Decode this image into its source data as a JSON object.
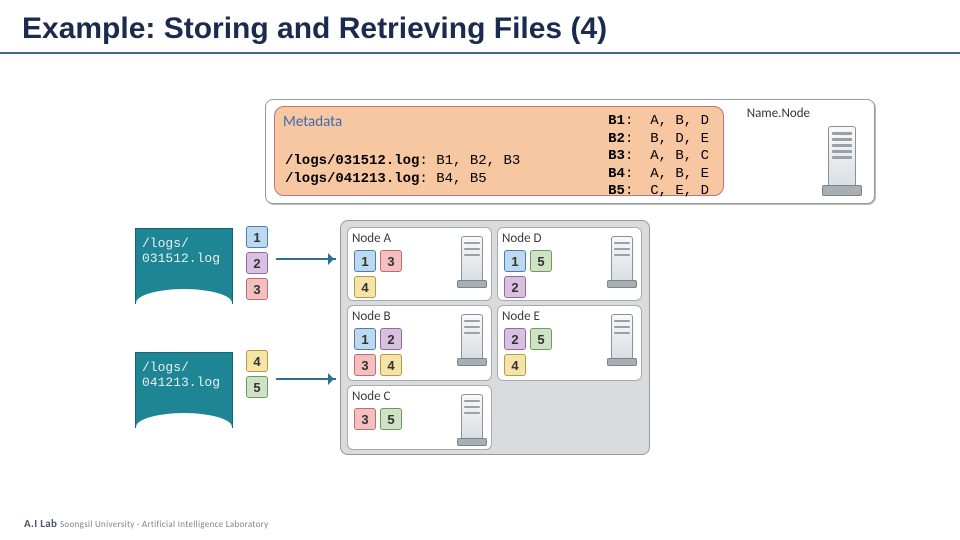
{
  "title": "Example: Storing and Retrieving Files (4)",
  "namenode": {
    "label": "Name.Node",
    "metadata_header": "Metadata",
    "files": [
      {
        "path": "/logs/031512.log",
        "blocks": "B1, B2, B3"
      },
      {
        "path": "/logs/041213.log",
        "blocks": "B4, B5"
      }
    ],
    "block_map": [
      {
        "id": "B1",
        "nodes": "A, B, D"
      },
      {
        "id": "B2",
        "nodes": "B, D, E"
      },
      {
        "id": "B3",
        "nodes": "A, B, C"
      },
      {
        "id": "B4",
        "nodes": "A, B, E"
      },
      {
        "id": "B5",
        "nodes": "C, E, D"
      }
    ]
  },
  "input_files": [
    {
      "path_line1": "/logs/",
      "path_line2": "031512.log",
      "blocks": [
        "1",
        "2",
        "3"
      ]
    },
    {
      "path_line1": "/logs/",
      "path_line2": "041213.log",
      "blocks": [
        "4",
        "5"
      ]
    }
  ],
  "datanodes": [
    {
      "name": "Node A",
      "blocks": [
        "1",
        "3",
        "4"
      ]
    },
    {
      "name": "Node B",
      "blocks": [
        "1",
        "2",
        "3",
        "4"
      ]
    },
    {
      "name": "Node C",
      "blocks": [
        "3",
        "5"
      ]
    },
    {
      "name": "Node D",
      "blocks": [
        "1",
        "5",
        "2"
      ]
    },
    {
      "name": "Node E",
      "blocks": [
        "2",
        "5",
        "4"
      ]
    }
  ],
  "footer": {
    "brand": "A.I Lab",
    "sub": "Soongsil University · Artificial Intelligence Laboratory"
  }
}
